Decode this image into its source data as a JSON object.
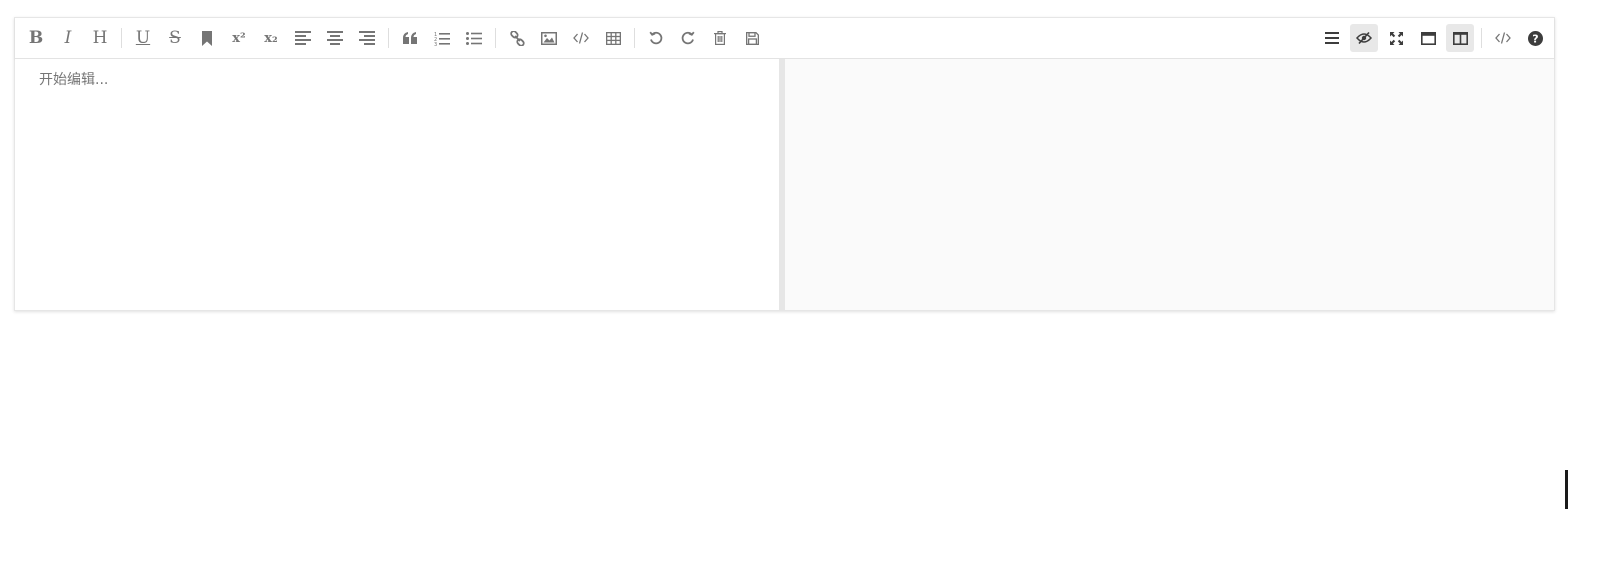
{
  "toolbar": {
    "left_buttons": [
      {
        "name": "bold-button",
        "icon": "bold-icon",
        "glyph": "B"
      },
      {
        "name": "italic-button",
        "icon": "italic-icon",
        "glyph": "I"
      },
      {
        "name": "header-button",
        "icon": "header-icon",
        "glyph": "H"
      },
      {
        "name": "underline-button",
        "icon": "underline-icon",
        "glyph": "U"
      },
      {
        "name": "strikethrough-button",
        "icon": "strikethrough-icon",
        "glyph": "S"
      },
      {
        "name": "mark-button",
        "icon": "bookmark-icon"
      },
      {
        "name": "superscript-button",
        "icon": "superscript-icon",
        "glyph": "x²"
      },
      {
        "name": "subscript-button",
        "icon": "subscript-icon",
        "glyph": "x₂"
      },
      {
        "name": "align-left-button",
        "icon": "align-left-icon"
      },
      {
        "name": "align-center-button",
        "icon": "align-center-icon"
      },
      {
        "name": "align-right-button",
        "icon": "align-right-icon"
      },
      {
        "name": "quote-button",
        "icon": "quote-icon"
      },
      {
        "name": "ordered-list-button",
        "icon": "ordered-list-icon"
      },
      {
        "name": "unordered-list-button",
        "icon": "unordered-list-icon"
      },
      {
        "name": "link-button",
        "icon": "link-icon"
      },
      {
        "name": "image-button",
        "icon": "image-icon"
      },
      {
        "name": "code-button",
        "icon": "code-icon"
      },
      {
        "name": "table-button",
        "icon": "table-icon"
      },
      {
        "name": "undo-button",
        "icon": "undo-icon"
      },
      {
        "name": "redo-button",
        "icon": "redo-icon"
      },
      {
        "name": "trash-button",
        "icon": "trash-icon"
      },
      {
        "name": "save-button",
        "icon": "save-icon"
      }
    ],
    "right_buttons": [
      {
        "name": "navigation-button",
        "icon": "menu-icon"
      },
      {
        "name": "preview-toggle-button",
        "icon": "eye-slash-icon",
        "active": true
      },
      {
        "name": "fullscreen-button",
        "icon": "expand-icon"
      },
      {
        "name": "read-mode-button",
        "icon": "window-icon"
      },
      {
        "name": "subfield-button",
        "icon": "columns-icon",
        "active": true
      },
      {
        "name": "html-code-button",
        "icon": "code-icon"
      },
      {
        "name": "help-button",
        "icon": "question-circle-icon"
      }
    ]
  },
  "editor": {
    "placeholder": "开始编辑..."
  },
  "colors": {
    "icon": "#757575",
    "border": "#e6e6e6",
    "preview_bg": "#fafafa",
    "active_bg": "#e8e8e8"
  }
}
